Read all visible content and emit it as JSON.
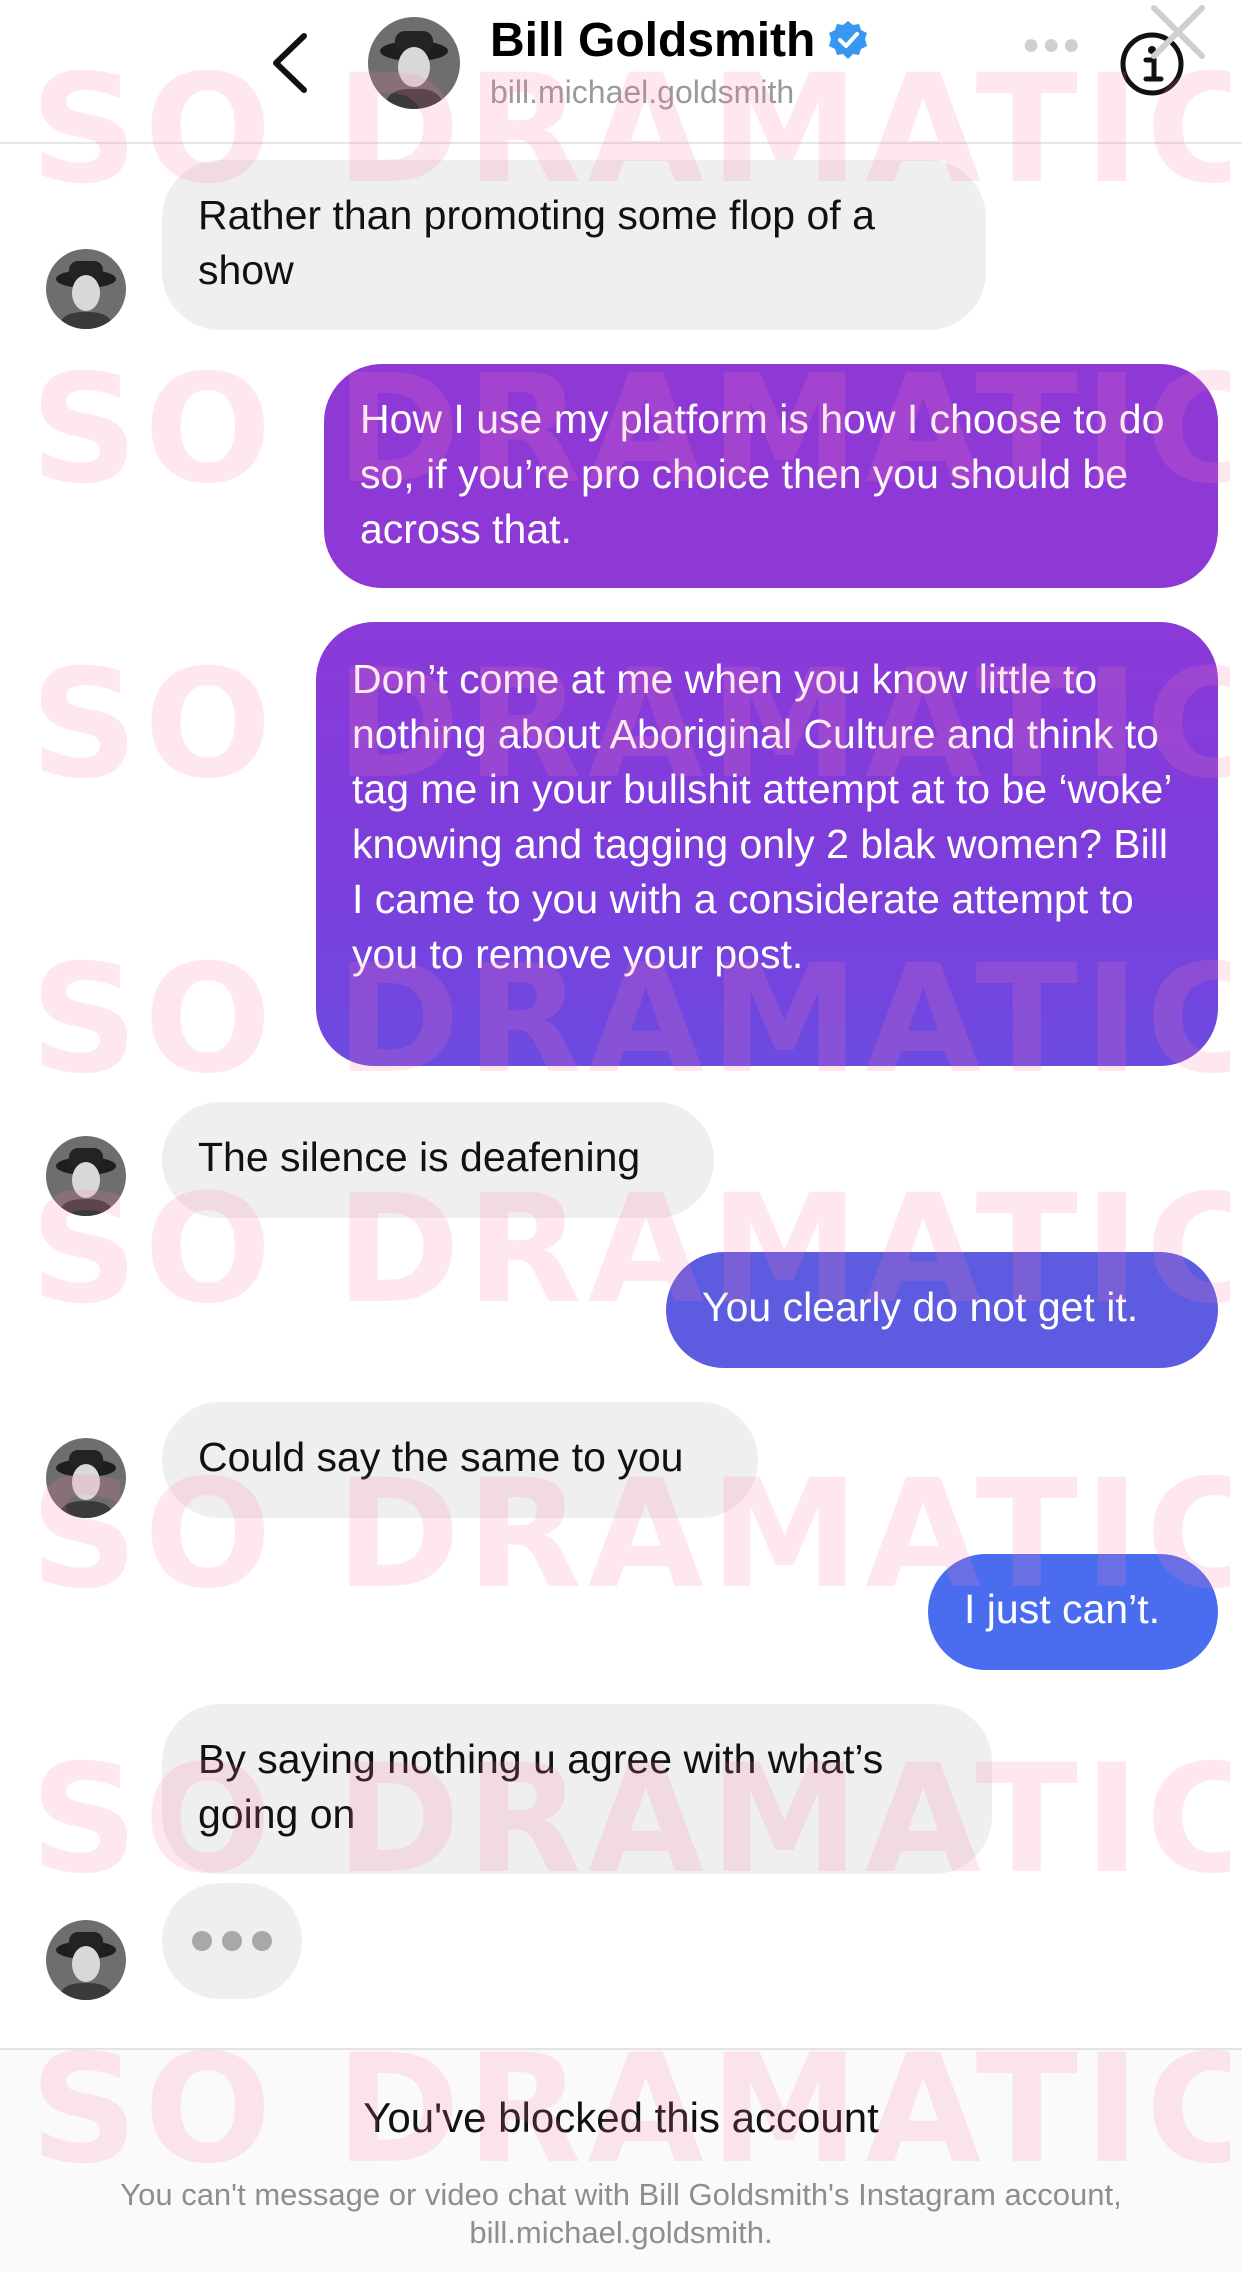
{
  "header": {
    "back_label": "Back",
    "name": "Bill Goldsmith",
    "username": "bill.michael.goldsmith",
    "verified": true
  },
  "messages": [
    {
      "sender": "them",
      "text": "Rather than promoting some flop of a show"
    },
    {
      "sender": "me",
      "text": "How I use my platform is how I choose to do so, if you’re pro choice then you should be across that."
    },
    {
      "sender": "me",
      "text": "Don’t come at me when you know little to nothing about Aboriginal Culture and think to tag me in your bullshit attempt at to be ‘woke’ knowing and tagging only 2 blak women? Bill I came to you with a considerate attempt to you to remove your post."
    },
    {
      "sender": "them",
      "text": "The silence is deafening"
    },
    {
      "sender": "me",
      "text": "You clearly do not get it."
    },
    {
      "sender": "them",
      "text": "Could say the same to you"
    },
    {
      "sender": "me",
      "text": "I just can’t."
    },
    {
      "sender": "them",
      "text": "By saying nothing u agree with what’s going on"
    }
  ],
  "typing_indicator": "•••",
  "footer": {
    "title": "You've blocked this account",
    "description": "You can't message or video chat with Bill Goldsmith's Instagram account, bill.michael.goldsmith."
  },
  "watermark_text": "SO DRAMATIC!",
  "colors": {
    "outgoing_purple": "#8e39d6",
    "outgoing_violet": "#7a3ed8",
    "outgoing_indigo": "#5d5be0",
    "outgoing_blue": "#4a6df0",
    "incoming_gray": "#efefef",
    "verified_blue": "#3897f0",
    "watermark_pink": "#ff78b4"
  }
}
